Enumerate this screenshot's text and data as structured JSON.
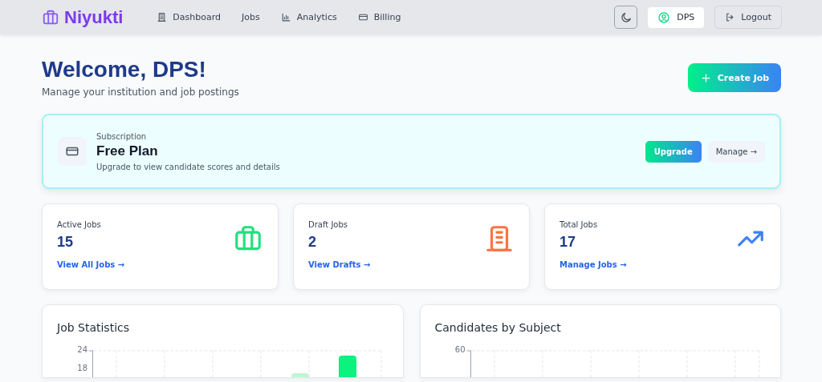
{
  "nav": {
    "brand": "Niyukti",
    "links": [
      {
        "label": "Dashboard"
      },
      {
        "label": "Jobs"
      },
      {
        "label": "Analytics"
      },
      {
        "label": "Billing"
      }
    ],
    "user": "DPS",
    "logout": "Logout"
  },
  "header": {
    "title": "Welcome, DPS!",
    "subtitle": "Manage your institution and job postings",
    "create_button": "Create Job"
  },
  "subscription": {
    "label": "Subscription",
    "plan": "Free Plan",
    "note": "Upgrade to view candidate scores and details",
    "upgrade": "Upgrade",
    "manage": "Manage →"
  },
  "stats": [
    {
      "label": "Active Jobs",
      "value": "15",
      "link": "View All Jobs →",
      "color": "#22e07f"
    },
    {
      "label": "Draft Jobs",
      "value": "2",
      "link": "View Drafts →",
      "color": "#f97341"
    },
    {
      "label": "Total Jobs",
      "value": "17",
      "link": "Manage Jobs →",
      "color": "#3b82f6"
    }
  ],
  "charts": [
    {
      "title": "Job Statistics",
      "y_tick_labels": [
        "24",
        "18"
      ],
      "kind": "bars"
    },
    {
      "title": "Candidates by Subject",
      "y_tick_labels": [
        "60"
      ],
      "kind": "empty"
    }
  ]
}
